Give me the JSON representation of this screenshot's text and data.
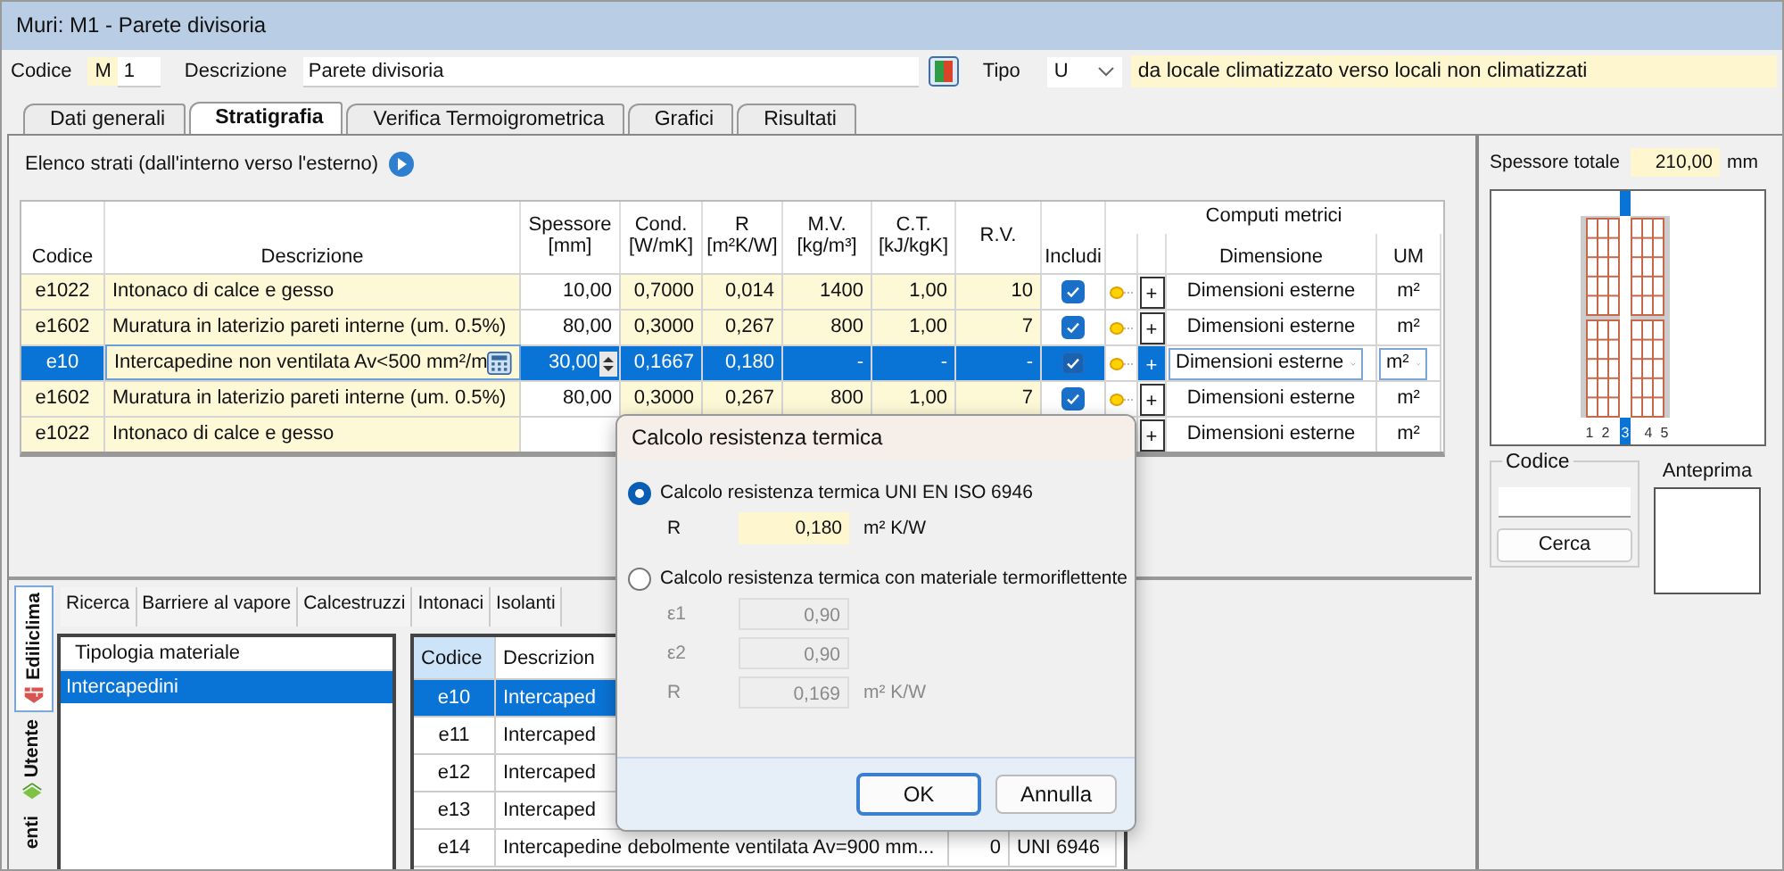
{
  "window": {
    "title": "Muri: M1 - Parete divisoria"
  },
  "header": {
    "code_label": "Codice",
    "code_prefix": "M",
    "code_number": "1",
    "description_label": "Descrizione",
    "description": "Parete divisoria",
    "type_label": "Tipo",
    "type_value": "U",
    "type_description": "da locale climatizzato verso locali non climatizzati"
  },
  "tabs": [
    {
      "label": "Dati generali",
      "selected": false
    },
    {
      "label": "Stratigrafia",
      "selected": true
    },
    {
      "label": "Verifica Termoigrometrica",
      "selected": false
    },
    {
      "label": "Grafici",
      "selected": false
    },
    {
      "label": "Risultati",
      "selected": false
    }
  ],
  "layers": {
    "title": "Elenco strati (dall'interno verso l'esterno)",
    "group_heading": "Computi metrici",
    "columns": [
      {
        "label": "Codice"
      },
      {
        "label": "Descrizione"
      },
      {
        "label": "Spessore",
        "unit": "[mm]"
      },
      {
        "label": "Cond.",
        "unit": "[W/mK]"
      },
      {
        "label": "R",
        "unit": "[m²K/W]"
      },
      {
        "label": "M.V.",
        "unit": "[kg/m³]"
      },
      {
        "label": "C.T.",
        "unit": "[kJ/kgK]"
      },
      {
        "label": "R.V."
      },
      {
        "label": "Includi"
      },
      {
        "label": "Dimensione"
      },
      {
        "label": "UM"
      }
    ],
    "rows": [
      {
        "code": "e1022",
        "description": "Intonaco di calce e gesso",
        "thickness": "10,00",
        "conductivity": "0,7000",
        "resistance": "0,014",
        "density": "1400",
        "heat_capacity": "1,00",
        "vapour_resistance": "10",
        "included": true,
        "add": "+",
        "dimension": "Dimensioni esterne",
        "unit": "m²",
        "selected": false
      },
      {
        "code": "e1602",
        "description": "Muratura in laterizio pareti interne (um. 0.5%)",
        "thickness": "80,00",
        "conductivity": "0,3000",
        "resistance": "0,267",
        "density": "800",
        "heat_capacity": "1,00",
        "vapour_resistance": "7",
        "included": true,
        "add": "+",
        "dimension": "Dimensioni esterne",
        "unit": "m²",
        "selected": false
      },
      {
        "code": "e10",
        "description": "Intercapedine non ventilata Av<500 mm²/m",
        "thickness": "30,00",
        "conductivity": "0,1667",
        "resistance": "0,180",
        "density": "-",
        "heat_capacity": "-",
        "vapour_resistance": "-",
        "included": true,
        "add": "+",
        "dimension": "Dimensioni esterne",
        "unit": "m²",
        "selected": true
      },
      {
        "code": "e1602",
        "description": "Muratura in laterizio pareti interne (um. 0.5%)",
        "thickness": "80,00",
        "conductivity": "0,3000",
        "resistance": "0,267",
        "density": "800",
        "heat_capacity": "1,00",
        "vapour_resistance": "7",
        "included": true,
        "add": "+",
        "dimension": "Dimensioni esterne",
        "unit": "m²",
        "selected": false
      },
      {
        "code": "e1022",
        "description": "Intonaco di calce e gesso",
        "add": "+",
        "dimension": "Dimensioni esterne",
        "unit": "m²",
        "selected": false
      }
    ]
  },
  "total_thickness": {
    "label": "Spessore totale",
    "value": "210,00",
    "unit": "mm"
  },
  "preview": {
    "layers": [
      {
        "label": "1",
        "selected": false
      },
      {
        "label": "2",
        "selected": false
      },
      {
        "label": "3",
        "selected": true
      },
      {
        "label": "4",
        "selected": false
      },
      {
        "label": "5",
        "selected": false
      }
    ]
  },
  "search": {
    "group_label": "Codice",
    "button": "Cerca",
    "preview_label": "Anteprima"
  },
  "library": {
    "side_tabs": [
      {
        "label": "Ediliclima",
        "selected": true
      },
      {
        "label": "Utente",
        "selected": false
      },
      {
        "label": "enti",
        "selected": false
      }
    ],
    "tabs": [
      "Ricerca",
      "Barriere al vapore",
      "Calcestruzzi",
      "Intonaci",
      "Isolanti"
    ],
    "tree_header": "Tipologia materiale",
    "categories": [
      {
        "label": "Intercapedini",
        "selected": true
      }
    ],
    "columns": [
      "Codice",
      "Descrizion"
    ],
    "rows": [
      {
        "code": "e10",
        "description": "Intercaped",
        "selected": true
      },
      {
        "code": "e11",
        "description": "Intercaped",
        "selected": false
      },
      {
        "code": "e12",
        "description": "Intercaped",
        "selected": false
      },
      {
        "code": "e13",
        "description": "Intercaped",
        "selected": false
      },
      {
        "code": "e14",
        "description": "Intercapedine debolmente ventilata Av=900 mm...",
        "column_3": "0",
        "column_4": "UNI 6946",
        "selected": false
      }
    ]
  },
  "dialog": {
    "title": "Calcolo resistenza termica",
    "options": [
      {
        "label": "Calcolo resistenza termica UNI EN ISO 6946",
        "selected": true,
        "fields": [
          {
            "label": "R",
            "value": "0,180",
            "unit": "m² K/W"
          }
        ]
      },
      {
        "label": "Calcolo resistenza termica con materiale termoriflettente",
        "selected": false,
        "fields": [
          {
            "label": "ε1",
            "value": "0,90"
          },
          {
            "label": "ε2",
            "value": "0,90"
          },
          {
            "label": "R",
            "value": "0,169",
            "unit": "m² K/W"
          }
        ]
      }
    ],
    "buttons": [
      "OK",
      "Annulla"
    ]
  }
}
